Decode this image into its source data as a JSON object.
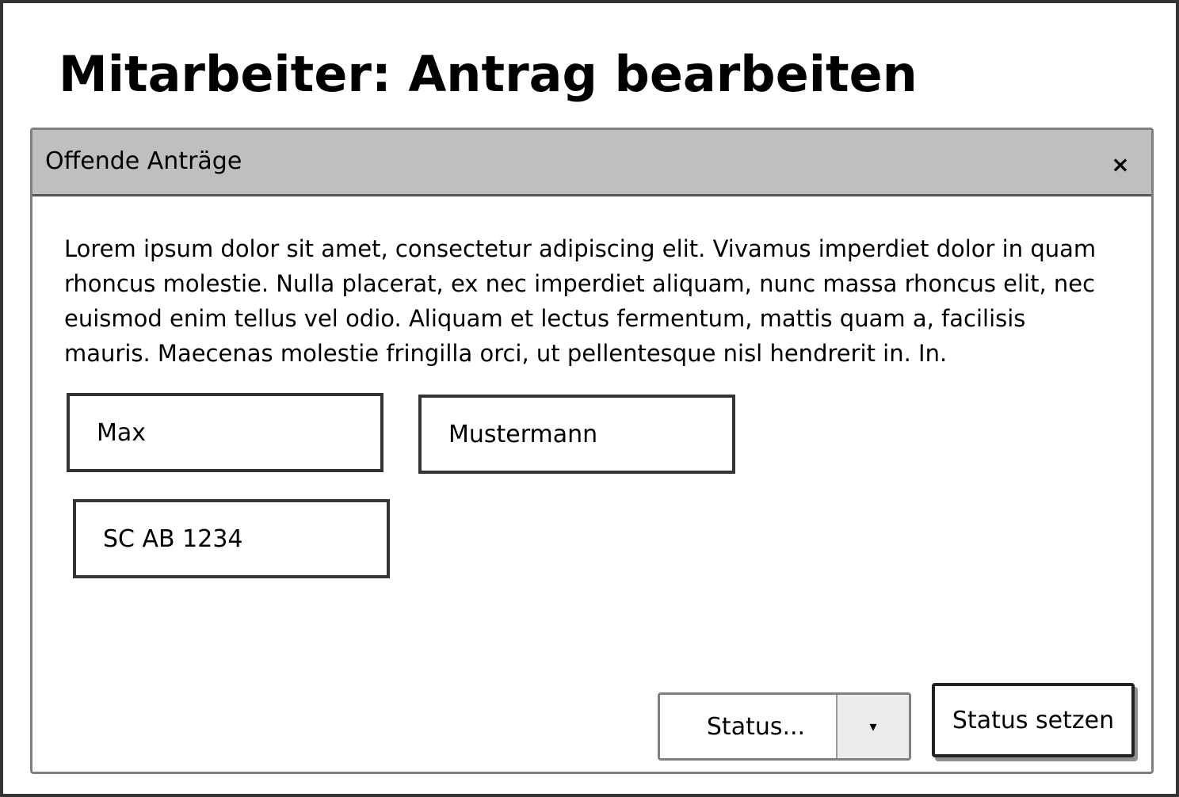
{
  "page": {
    "title": "Mitarbeiter: Antrag bearbeiten"
  },
  "window": {
    "title": "Offende Anträge",
    "close_label": "×",
    "description": "Lorem ipsum dolor sit amet, consectetur adipiscing elit. Vivamus imperdiet dolor in quam rhoncus molestie. Nulla placerat, ex nec imperdiet aliquam, nunc massa rhoncus elit, nec euismod enim tellus vel odio. Aliquam et lectus fermentum, mattis quam a, facilisis mauris. Maecenas molestie fringilla orci, ut pellentesque nisl hendrerit in. In."
  },
  "form": {
    "first_name": "Max",
    "last_name": "Mustermann",
    "code": "SC AB 1234"
  },
  "status": {
    "select_value": "Status...",
    "arrow": "▾",
    "button_label": "Status setzen"
  },
  "icons": {
    "close": "close-icon",
    "dropdown": "chevron-down-icon"
  },
  "colors": {
    "titlebar": "#bfbfbf",
    "border": "#333333",
    "dropdown_arrow_bg": "#ececec"
  }
}
